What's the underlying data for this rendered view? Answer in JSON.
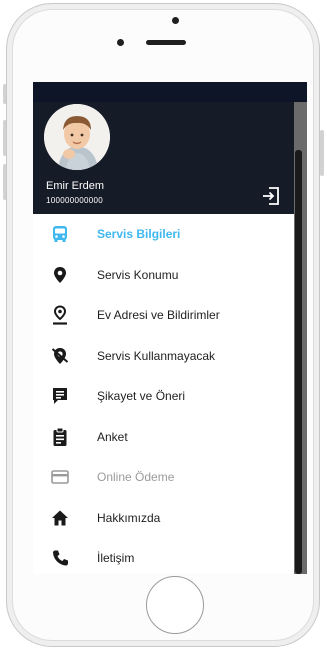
{
  "user": {
    "name": "Emir Erdem",
    "id": "100000000000"
  },
  "menu": {
    "items": [
      {
        "label": "Servis Bilgileri",
        "icon": "bus-icon",
        "state": "active"
      },
      {
        "label": "Servis Konumu",
        "icon": "map-pin-icon",
        "state": "normal"
      },
      {
        "label": "Ev Adresi ve Bildirimler",
        "icon": "home-location-icon",
        "state": "normal"
      },
      {
        "label": "Servis Kullanmayacak",
        "icon": "location-off-icon",
        "state": "normal"
      },
      {
        "label": "Şikayet ve Öneri",
        "icon": "feedback-icon",
        "state": "normal"
      },
      {
        "label": "Anket",
        "icon": "clipboard-icon",
        "state": "normal"
      },
      {
        "label": "Online Ödeme",
        "icon": "credit-card-icon",
        "state": "disabled"
      },
      {
        "label": "Hakkımızda",
        "icon": "home-icon",
        "state": "normal"
      },
      {
        "label": "İletişim",
        "icon": "phone-icon",
        "state": "normal"
      }
    ]
  },
  "colors": {
    "active": "#3fb8ef",
    "header_bg": "#161b28",
    "status_bar": "#0e1528",
    "text": "#1f1f1f",
    "disabled": "#9a9a9a"
  }
}
